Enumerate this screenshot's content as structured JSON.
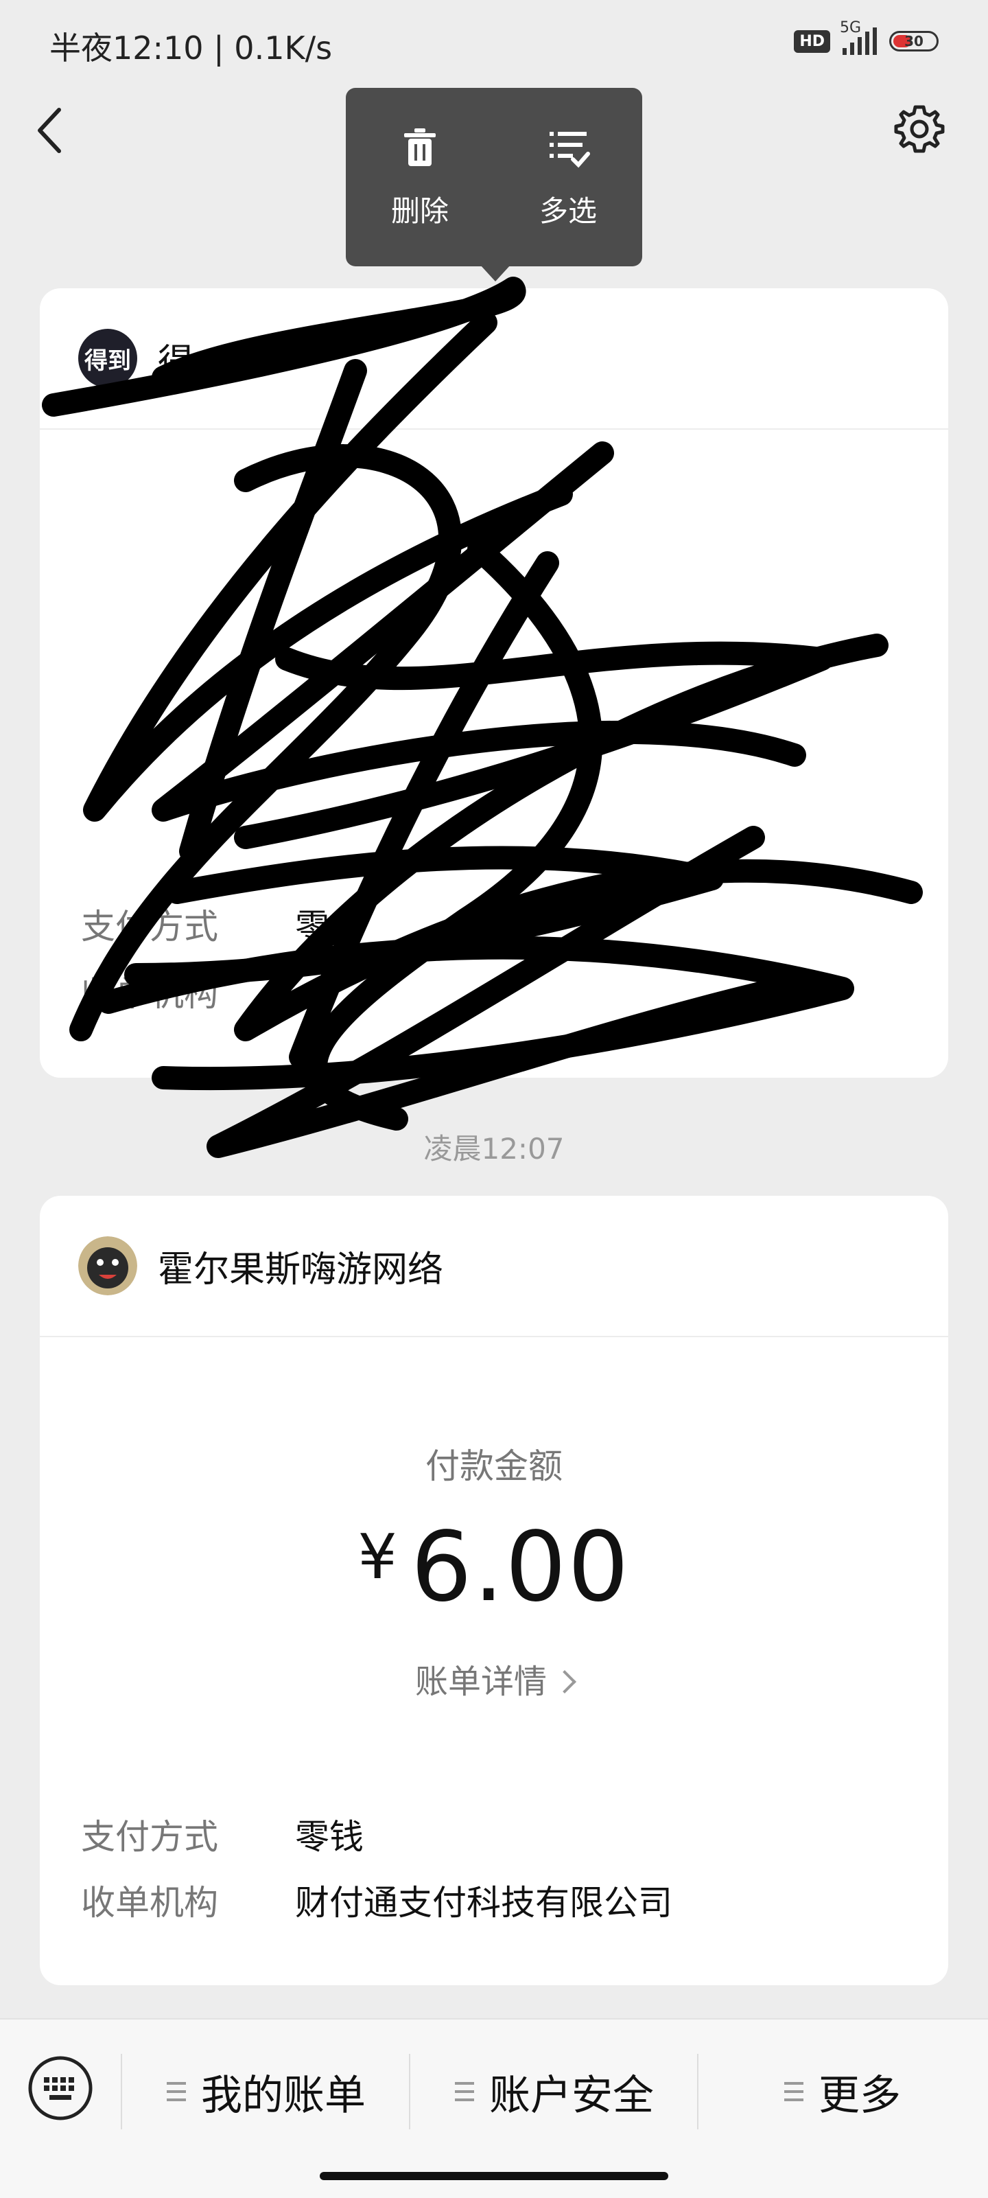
{
  "status_bar": {
    "time": "半夜12:10 | 0.1K/s",
    "hd_label": "HD",
    "network_label": "5G",
    "battery_level": "30"
  },
  "context_menu": {
    "delete_label": "删除",
    "multiselect_label": "多选"
  },
  "card1": {
    "merchant_name_partial": "得",
    "avatar_text": "得到",
    "payment_method_label": "支付方式",
    "payment_method_partial": "零",
    "acquirer_label": "收单机构"
  },
  "timestamp": "凌晨12:07",
  "card2": {
    "merchant_name": "霍尔果斯嗨游网络",
    "amount_label": "付款金额",
    "currency_symbol": "¥",
    "amount": "6.00",
    "bill_detail_link": "账单详情",
    "payment_method_label": "支付方式",
    "payment_method_value": "零钱",
    "acquirer_label": "收单机构",
    "acquirer_value": "财付通支付科技有限公司"
  },
  "bottom_bar": {
    "tabs": [
      {
        "label": "我的账单"
      },
      {
        "label": "账户安全"
      },
      {
        "label": "更多"
      }
    ]
  },
  "colors": {
    "background": "#ededed",
    "card": "#ffffff",
    "popup": "#4c4c4c",
    "secondary_text": "#777777"
  }
}
